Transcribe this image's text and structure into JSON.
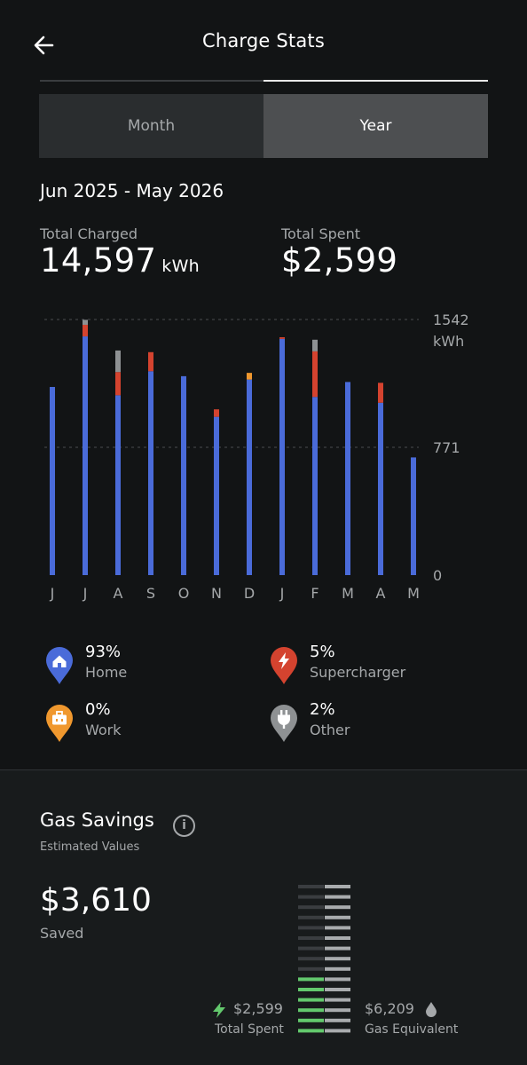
{
  "header": {
    "title": "Charge Stats",
    "back_icon": "arrow-left-icon"
  },
  "tabs": {
    "month_label": "Month",
    "year_label": "Year",
    "selected": "Year"
  },
  "period": {
    "range": "Jun 2025 - May 2026"
  },
  "stats": {
    "total_charged_label": "Total Charged",
    "total_charged_value": "14,597",
    "total_charged_unit": "kWh",
    "total_spent_label": "Total Spent",
    "total_spent_value": "$2,599"
  },
  "colors": {
    "home": "#4a6bd9",
    "supercharger": "#d4432f",
    "work": "#f0982e",
    "other": "#8e9193",
    "savings_green": "#63c96d",
    "background": "#121415"
  },
  "chart_data": {
    "type": "bar",
    "stacked": true,
    "categories": [
      "J",
      "J",
      "A",
      "S",
      "O",
      "N",
      "D",
      "J",
      "F",
      "M",
      "A",
      "M"
    ],
    "series": [
      {
        "name": "Home",
        "values": [
          1135,
          1440,
          1085,
          1230,
          1200,
          955,
          1180,
          1425,
          1075,
          1165,
          1040,
          710
        ]
      },
      {
        "name": "Supercharger",
        "values": [
          0,
          70,
          140,
          115,
          0,
          45,
          0,
          10,
          275,
          0,
          120,
          0
        ]
      },
      {
        "name": "Work",
        "values": [
          0,
          0,
          0,
          0,
          0,
          0,
          40,
          0,
          0,
          0,
          0,
          0
        ]
      },
      {
        "name": "Other",
        "values": [
          0,
          30,
          130,
          0,
          0,
          0,
          0,
          0,
          70,
          0,
          0,
          0
        ]
      }
    ],
    "y_ticks": [
      "1542",
      "771",
      "0"
    ],
    "y_unit": "kWh",
    "ylim": [
      0,
      1542
    ],
    "grid": true
  },
  "legend": [
    {
      "pct": "93%",
      "name": "Home",
      "icon": "home-icon"
    },
    {
      "pct": "5%",
      "name": "Supercharger",
      "icon": "lightning-icon"
    },
    {
      "pct": "0%",
      "name": "Work",
      "icon": "briefcase-icon"
    },
    {
      "pct": "2%",
      "name": "Other",
      "icon": "plug-icon"
    }
  ],
  "gas_savings": {
    "title": "Gas Savings",
    "subtitle": "Estimated Values",
    "saved_value": "$3,610",
    "saved_label": "Saved",
    "spent_value": "$2,599",
    "spent_label": "Total Spent",
    "gas_value": "$6,209",
    "gas_label": "Gas Equivalent",
    "spent_amount": 2599,
    "gas_amount": 6209
  }
}
